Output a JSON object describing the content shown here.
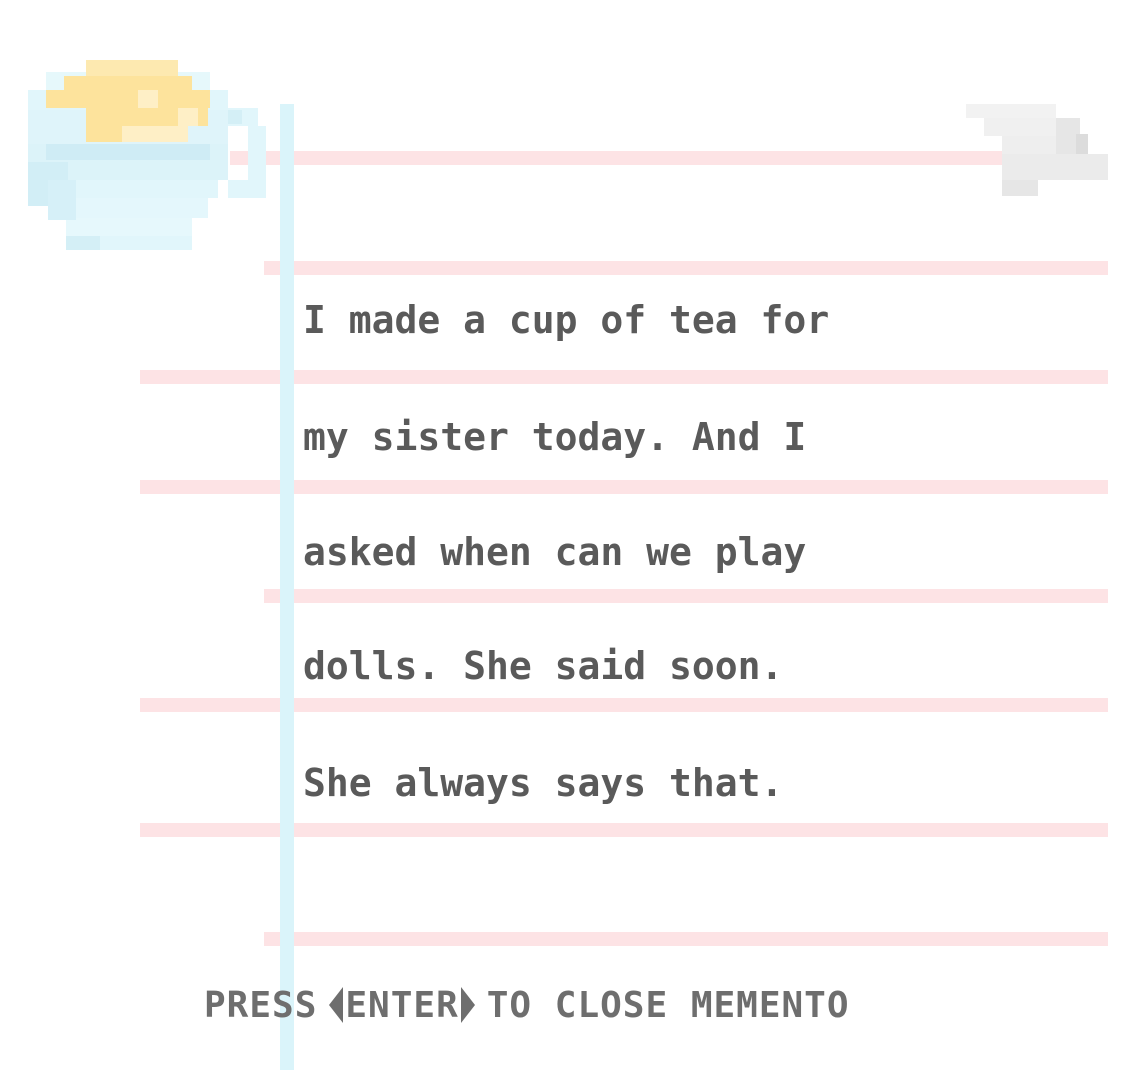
{
  "memento": {
    "lines": [
      "I made a cup of tea for",
      "my sister today. And I",
      "asked when can we play",
      "dolls. She said soon.",
      "She always says that."
    ],
    "icon": "teacup-icon",
    "corner_icon": "folded-paper-icon"
  },
  "hint": {
    "press": "PRESS",
    "key": "ENTER",
    "action": "TO CLOSE MEMENTO"
  },
  "colors": {
    "ruled_line": "#fde3e5",
    "margin_line": "#daf4fa",
    "text": "#5a5a5a",
    "hint_text": "#6e6e6e",
    "tea": "#fde39c",
    "cup": "#e1f6fb"
  }
}
